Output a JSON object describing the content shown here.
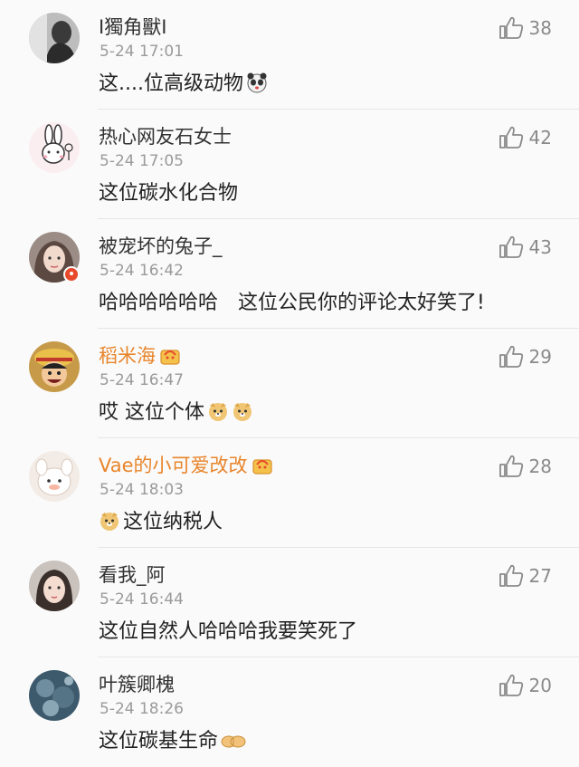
{
  "comments": [
    {
      "user": "I獨角獸I",
      "time": "5-24 17:01",
      "text": "这....位高级动物",
      "likes": "38",
      "emoji": "panda-icon"
    },
    {
      "user": "热心网友石女士",
      "time": "5-24 17:05",
      "text": "这位碳水化合物",
      "likes": "42"
    },
    {
      "user": "被宠坏的兔子_",
      "time": "5-24 16:42",
      "text": "哈哈哈哈哈哈　这位公民你的评论太好笑了!",
      "likes": "43",
      "verified": true
    },
    {
      "user": "稻米海",
      "time": "5-24 16:47",
      "text": "哎 这位个体",
      "likes": "29",
      "vip": true,
      "emoji": "doge-icon"
    },
    {
      "user": "Vae的小可爱改改",
      "time": "5-24 18:03",
      "text": "这位纳税人",
      "likes": "28",
      "vip": true,
      "emoji_prefix": "doge-icon"
    },
    {
      "user": "看我_阿",
      "time": "5-24 16:44",
      "text": "这位自然人哈哈哈我要笑死了",
      "likes": "27"
    },
    {
      "user": "叶簇卿槐",
      "time": "5-24 18:26",
      "text": "这位碳基生命",
      "likes": "20",
      "emoji": "fist-bump-icon"
    }
  ],
  "colors": {
    "vip_name": "#e8852b",
    "badge": "#e8492b",
    "muted": "#9a9a9a"
  }
}
